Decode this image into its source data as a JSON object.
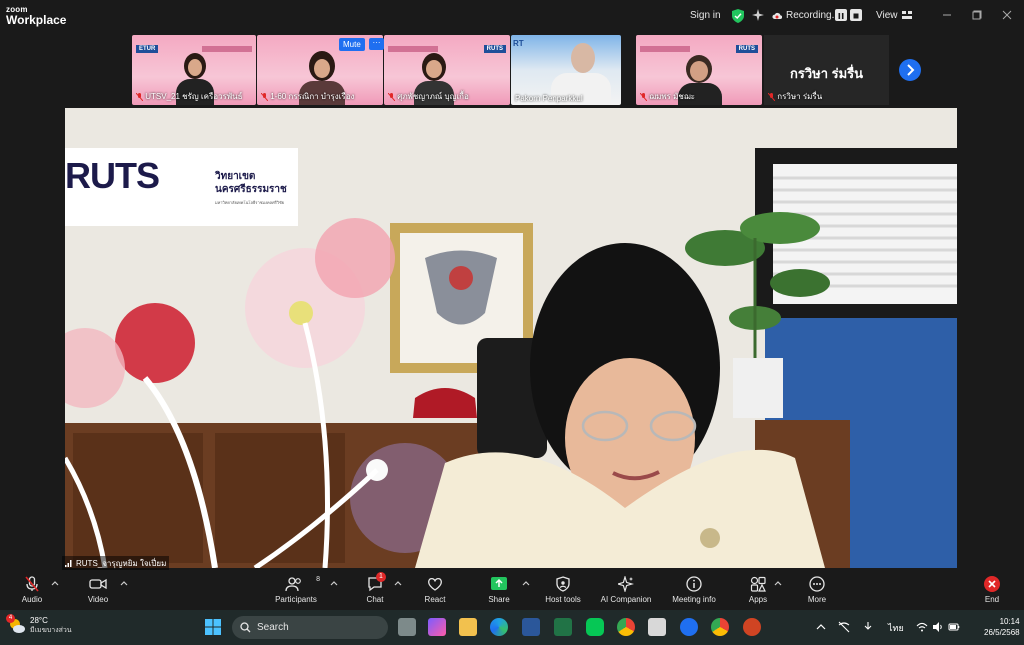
{
  "app": {
    "brand_line1": "zoom",
    "brand_line2": "Workplace"
  },
  "titlebar": {
    "signin_label": "Sign in",
    "recording_label": "Recording...",
    "view_label": "View"
  },
  "thumbnails": [
    {
      "name": "UTSV_21 ชรัญ เครือวรพันธ์",
      "banner": "ETUR"
    },
    {
      "name": "1-60 กรรณิกา บำรุงเรือง",
      "banner": ""
    },
    {
      "name": "ศุภพัชญาภณ์ บุญเกื้อ",
      "banner": "RUTS"
    },
    {
      "name": "Pakorn Penparkkul",
      "banner": "RT"
    },
    {
      "name": "ฌมพร มัชฌะ",
      "banner": "RUTS"
    }
  ],
  "mute_label": "Mute",
  "more_label": "···",
  "name_tile": {
    "display": "กรวิษา ร่มรื่น",
    "label": "กรวิษา ร่มรื่น"
  },
  "main_video": {
    "participant_label": "RUTS_จารุญหยิม ใจเปี่ยม",
    "sign_logo": "RUTS",
    "sign_line1": "วิทยาเขต",
    "sign_line2": "นครศรีธรรมราช",
    "sign_small": "มหาวิทยาลัยเทคโนโลยีราชมงคลศรีวิชัย"
  },
  "controls": {
    "audio": "Audio",
    "video": "Video",
    "participants": "Participants",
    "participants_count": "8",
    "chat": "Chat",
    "chat_badge": "1",
    "react": "React",
    "share": "Share",
    "host_tools": "Host tools",
    "ai_companion": "AI Companion",
    "meeting_info": "Meeting info",
    "apps": "Apps",
    "more": "More",
    "end": "End"
  },
  "taskbar": {
    "weather_temp": "28°C",
    "weather_desc": "มีเมฆบางส่วน",
    "weather_badge": "4",
    "search_placeholder": "Search",
    "lang": "ไทย",
    "time": "10:14",
    "date": "26/5/2568"
  },
  "colors": {
    "accent": "#1f6ff0",
    "end_red": "#e02828",
    "share_green": "#22c55e",
    "rec_red": "#e02828"
  }
}
